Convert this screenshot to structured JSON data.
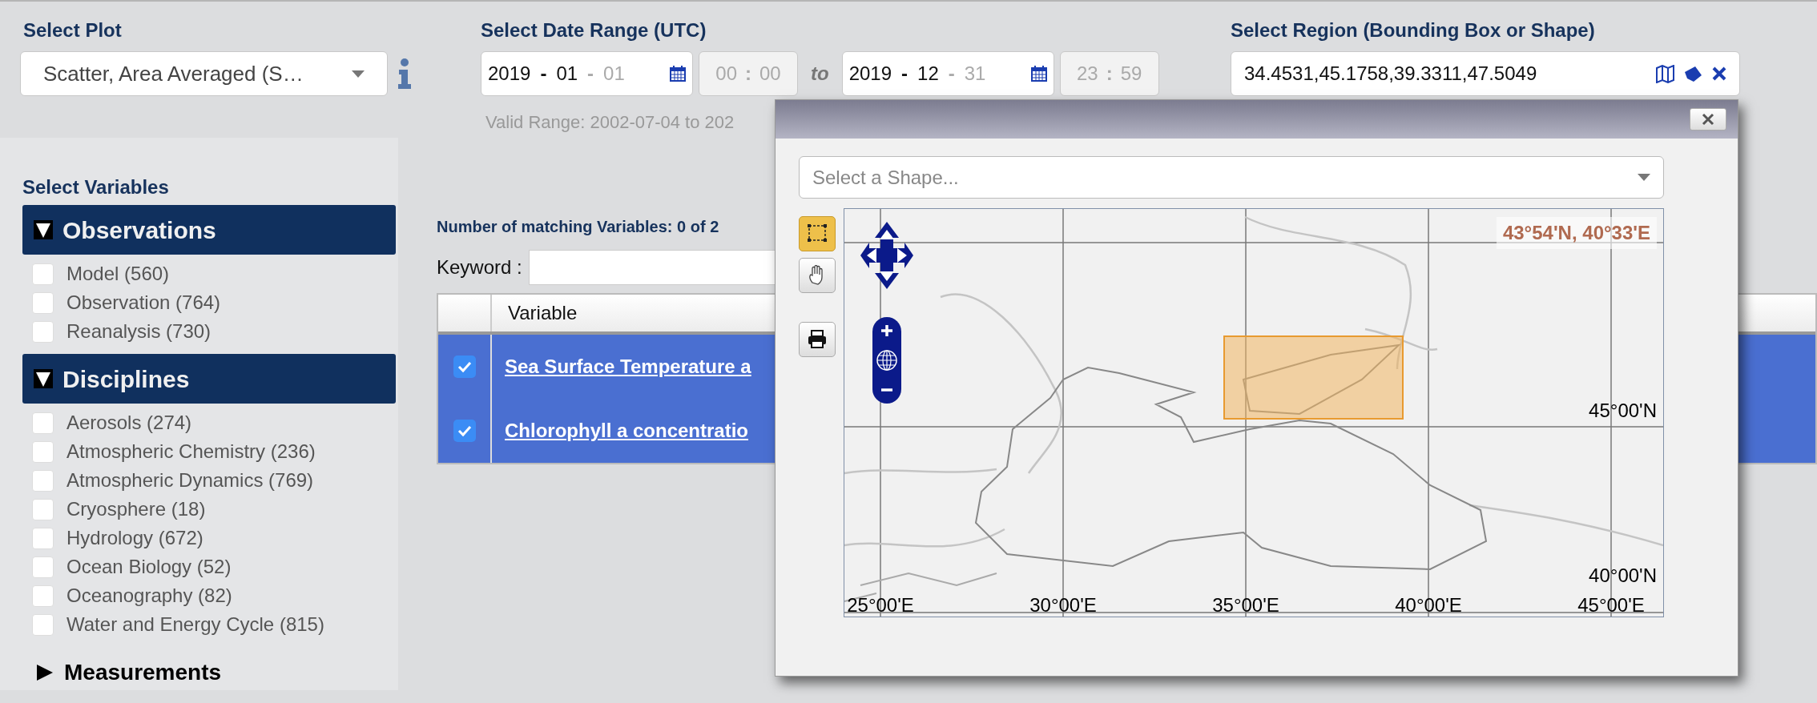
{
  "plot": {
    "label": "Select Plot",
    "value": "Scatter, Area Averaged (S…"
  },
  "date_range": {
    "label": "Select Date Range (UTC)",
    "start": {
      "date_parts": [
        {
          "text": "2019",
          "dim": false
        },
        {
          "text": "-",
          "dim": false
        },
        {
          "text": "01",
          "dim": false
        },
        {
          "text": "-",
          "dim": true
        },
        {
          "text": "01",
          "dim": true
        }
      ],
      "time_parts": [
        {
          "text": "00",
          "dim": true
        },
        {
          "text": ":",
          "dim": true
        },
        {
          "text": "00",
          "dim": true
        }
      ]
    },
    "separator": "to",
    "end": {
      "date_parts": [
        {
          "text": "2019",
          "dim": false
        },
        {
          "text": "-",
          "dim": false
        },
        {
          "text": "12",
          "dim": false
        },
        {
          "text": "-",
          "dim": true
        },
        {
          "text": "31",
          "dim": true
        }
      ],
      "time_parts": [
        {
          "text": "23",
          "dim": true
        },
        {
          "text": ":",
          "dim": true
        },
        {
          "text": "59",
          "dim": true
        }
      ]
    },
    "valid_range": "Valid Range: 2002-07-04 to 202"
  },
  "region": {
    "label": "Select Region (Bounding Box or Shape)",
    "value": "34.4531,45.1758,39.3311,47.5049"
  },
  "variables_panel": {
    "title": "Select Variables",
    "sections": [
      {
        "title": "Observations",
        "expanded": true,
        "items": [
          {
            "label": "Model (560)",
            "checked": false
          },
          {
            "label": "Observation (764)",
            "checked": false
          },
          {
            "label": "Reanalysis (730)",
            "checked": false
          }
        ]
      },
      {
        "title": "Disciplines",
        "expanded": true,
        "items": [
          {
            "label": "Aerosols (274)",
            "checked": false
          },
          {
            "label": "Atmospheric Chemistry (236)",
            "checked": false
          },
          {
            "label": "Atmospheric Dynamics (769)",
            "checked": false
          },
          {
            "label": "Cryosphere (18)",
            "checked": false
          },
          {
            "label": "Hydrology (672)",
            "checked": false
          },
          {
            "label": "Ocean Biology (52)",
            "checked": false
          },
          {
            "label": "Oceanography (82)",
            "checked": false
          },
          {
            "label": "Water and Energy Cycle (815)",
            "checked": false
          }
        ]
      },
      {
        "title": "Measurements",
        "expanded": false
      }
    ]
  },
  "results": {
    "count_text": "Number of matching Variables: 0 of 2",
    "keyword_label": "Keyword :",
    "variable_column": "Variable",
    "rows": [
      {
        "name": "Sea Surface Temperature a",
        "checked": true,
        "selected": true
      },
      {
        "name": "Chlorophyll a concentratio",
        "checked": true,
        "selected": true
      }
    ]
  },
  "region_dialog": {
    "shape_placeholder": "Select a Shape...",
    "tools": [
      {
        "kind": "box",
        "selected": true
      },
      {
        "kind": "pan",
        "selected": false
      },
      {
        "kind": "print",
        "selected": false
      }
    ],
    "map": {
      "readout": "43°54'N, 40°33'E",
      "lat_labels": [
        "45°00'N",
        "40°00'N"
      ],
      "lon_labels": [
        "25°00'E",
        "30°00'E",
        "35°00'E",
        "40°00'E",
        "45°00'E"
      ]
    }
  }
}
